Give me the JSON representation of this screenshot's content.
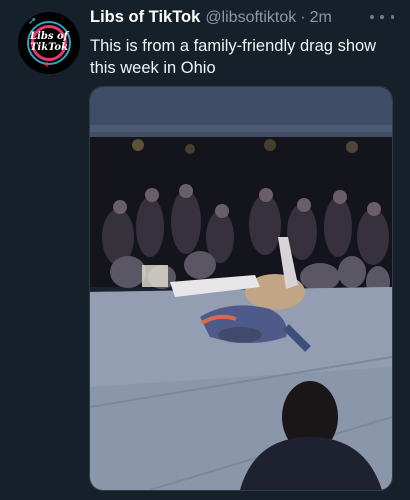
{
  "tweet": {
    "display_name": "Libs of TikTok",
    "handle": "@libsoftiktok",
    "separator": "·",
    "time": "2m",
    "text": "This is from a family-friendly drag show this week in Ohio",
    "avatar_text_line1": "Libs of",
    "avatar_text_line2": "TikTok",
    "more_icon": "more-horizontal-icon"
  },
  "colors": {
    "background": "#15202b",
    "primary_text": "#ffffff",
    "secondary_text": "#8b98a5",
    "avatar_pink": "#e8366f",
    "avatar_cyan": "#35c6e0"
  }
}
